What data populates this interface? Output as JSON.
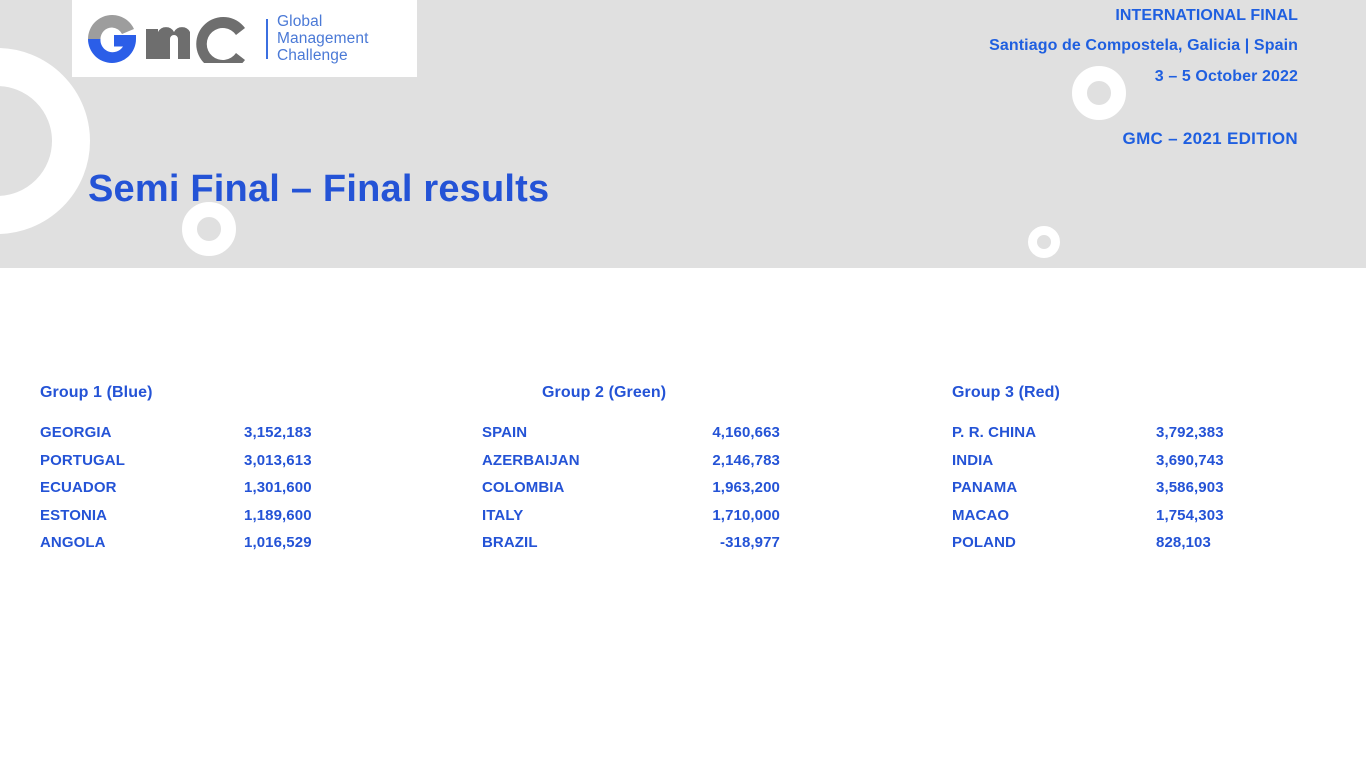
{
  "header": {
    "logo": {
      "mark_text": "GMC",
      "wordmark_line_1": "Global",
      "wordmark_line_2": "Management",
      "wordmark_line_3": "Challenge",
      "gray_color": "#7a7a7a",
      "blue_color": "#2b5ee8"
    },
    "meta": {
      "line_1": "INTERNATIONAL FINAL",
      "line_2": "Santiago de Compostela, Galicia | Spain",
      "line_3": "3 – 5 October 2022",
      "edition": "GMC – 2021  EDITION"
    },
    "band_color": "#e0e0e0",
    "accent_color": "#1f5fe0"
  },
  "title": "Semi Final – Final results",
  "results": {
    "groups": [
      {
        "heading": "Group 1 (Blue)",
        "color_name": "Blue",
        "rows": [
          {
            "team": "GEORGIA",
            "score": "3,152,183"
          },
          {
            "team": "PORTUGAL",
            "score": "3,013,613"
          },
          {
            "team": "ECUADOR",
            "score": "1,301,600"
          },
          {
            "team": "ESTONIA",
            "score": "1,189,600"
          },
          {
            "team": "ANGOLA",
            "score": "1,016,529"
          }
        ]
      },
      {
        "heading": "Group 2 (Green)",
        "color_name": "Green",
        "rows": [
          {
            "team": "SPAIN",
            "score": "4,160,663"
          },
          {
            "team": "AZERBAIJAN",
            "score": "2,146,783"
          },
          {
            "team": "COLOMBIA",
            "score": "1,963,200"
          },
          {
            "team": "ITALY",
            "score": "1,710,000"
          },
          {
            "team": "BRAZIL",
            "score": "-318,977"
          }
        ]
      },
      {
        "heading": "Group 3 (Red)",
        "color_name": "Red",
        "rows": [
          {
            "team": "P. R. CHINA",
            "score": "3,792,383"
          },
          {
            "team": "INDIA",
            "score": "3,690,743"
          },
          {
            "team": "PANAMA",
            "score": "3,586,903"
          },
          {
            "team": "MACAO",
            "score": "1,754,303"
          },
          {
            "team": "POLAND",
            "score": "828,103"
          }
        ]
      }
    ]
  }
}
